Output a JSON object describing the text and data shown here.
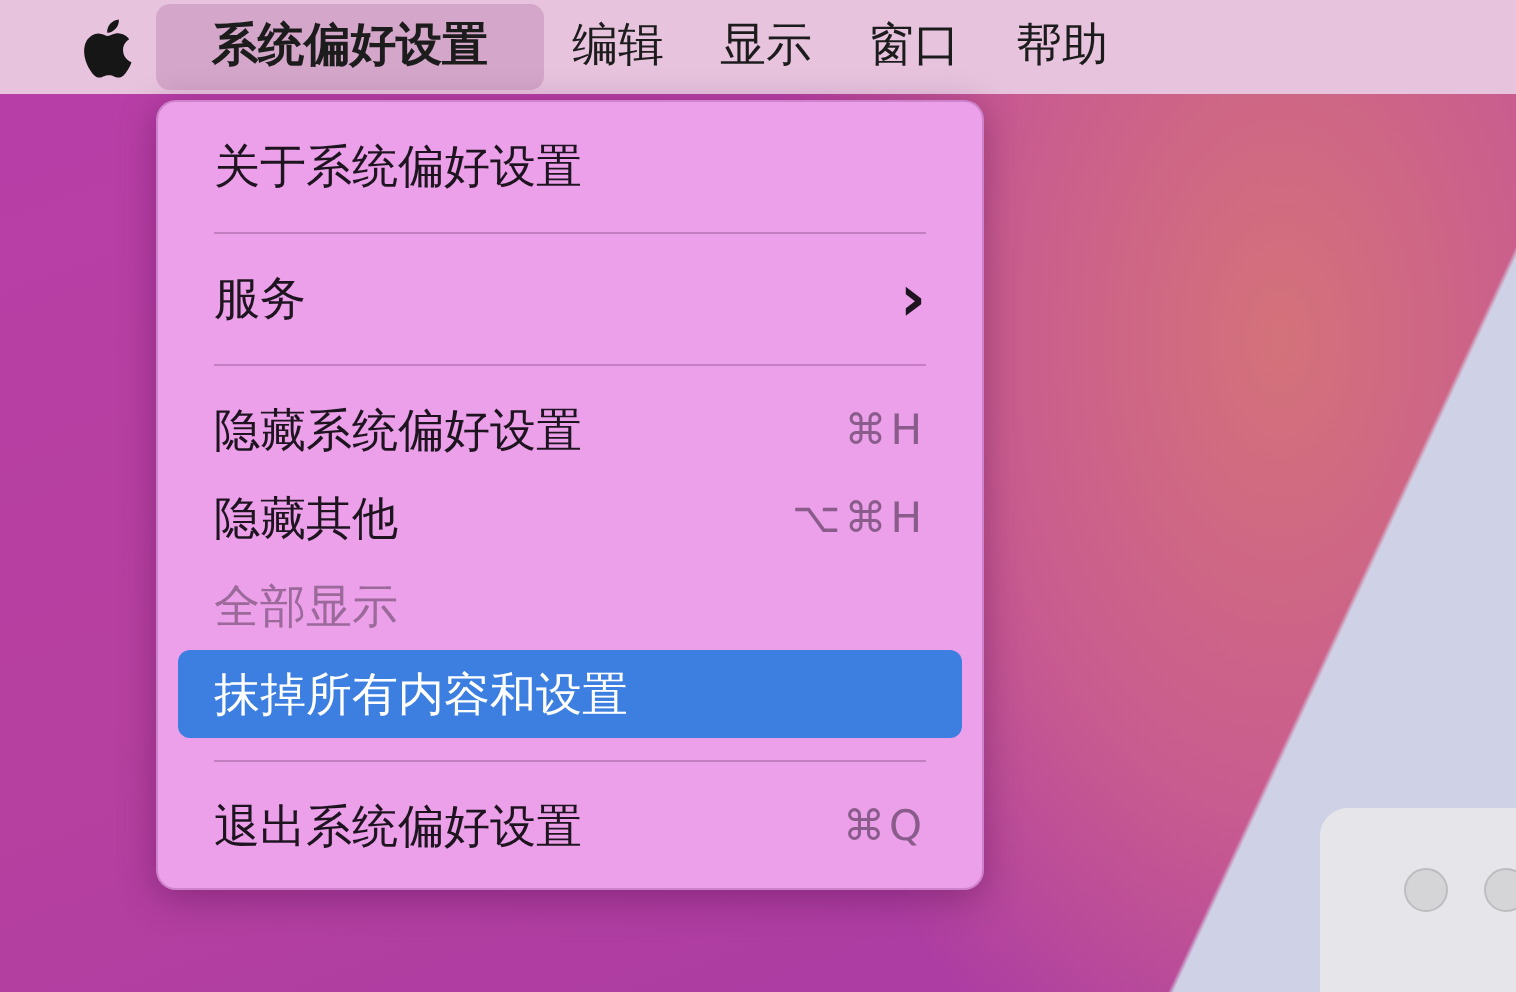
{
  "menu_bar": {
    "items": [
      {
        "label": "系统偏好设置",
        "selected": true,
        "bold": true
      },
      {
        "label": "编辑",
        "selected": false,
        "bold": false
      },
      {
        "label": "显示",
        "selected": false,
        "bold": false
      },
      {
        "label": "窗口",
        "selected": false,
        "bold": false
      },
      {
        "label": "帮助",
        "selected": false,
        "bold": false
      }
    ]
  },
  "menu": {
    "items": [
      {
        "kind": "item",
        "label": "关于系统偏好设置",
        "disabled": false,
        "selected": false
      },
      {
        "kind": "separator"
      },
      {
        "kind": "submenu",
        "label": "服务",
        "arrow": "›",
        "disabled": false,
        "selected": false
      },
      {
        "kind": "separator"
      },
      {
        "kind": "item",
        "label": "隐藏系统偏好设置",
        "shortcut": "⌘H",
        "disabled": false,
        "selected": false
      },
      {
        "kind": "item",
        "label": "隐藏其他",
        "shortcut": "⌥⌘H",
        "disabled": false,
        "selected": false
      },
      {
        "kind": "item",
        "label": "全部显示",
        "disabled": true,
        "selected": false
      },
      {
        "kind": "item",
        "label": "抹掉所有内容和设置",
        "disabled": false,
        "selected": true
      },
      {
        "kind": "separator"
      },
      {
        "kind": "item",
        "label": "退出系统偏好设置",
        "shortcut": "⌘Q",
        "disabled": false,
        "selected": false
      }
    ]
  }
}
